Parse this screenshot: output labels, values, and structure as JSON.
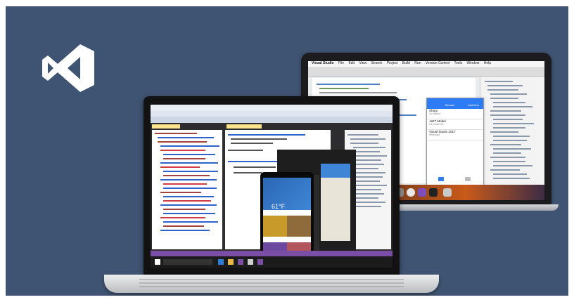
{
  "colors": {
    "background": "#3f5472",
    "vs_purple": "#7a4ea4",
    "ios_blue": "#2d7cf6",
    "android_blue": "#2b67b5"
  },
  "logo": {
    "icon": "visual-studio-logo"
  },
  "mac": {
    "menubar": [
      "Visual Studio",
      "File",
      "Edit",
      "View",
      "Search",
      "Project",
      "Build",
      "Run",
      "Version Control",
      "Tools",
      "Window",
      "Help"
    ],
    "ios_app": {
      "nav_left": "Browse",
      "nav_right": "Add Item",
      "items": [
        {
          "title": "Sharp",
          "sub": "C# feature"
        },
        {
          "title": ".NET Model",
          "sub": "C# model file"
        },
        {
          "title": "Visual Studio 2017",
          "sub": "Released"
        }
      ]
    }
  },
  "pc": {
    "android_app": {
      "temperature": "61°F"
    }
  }
}
